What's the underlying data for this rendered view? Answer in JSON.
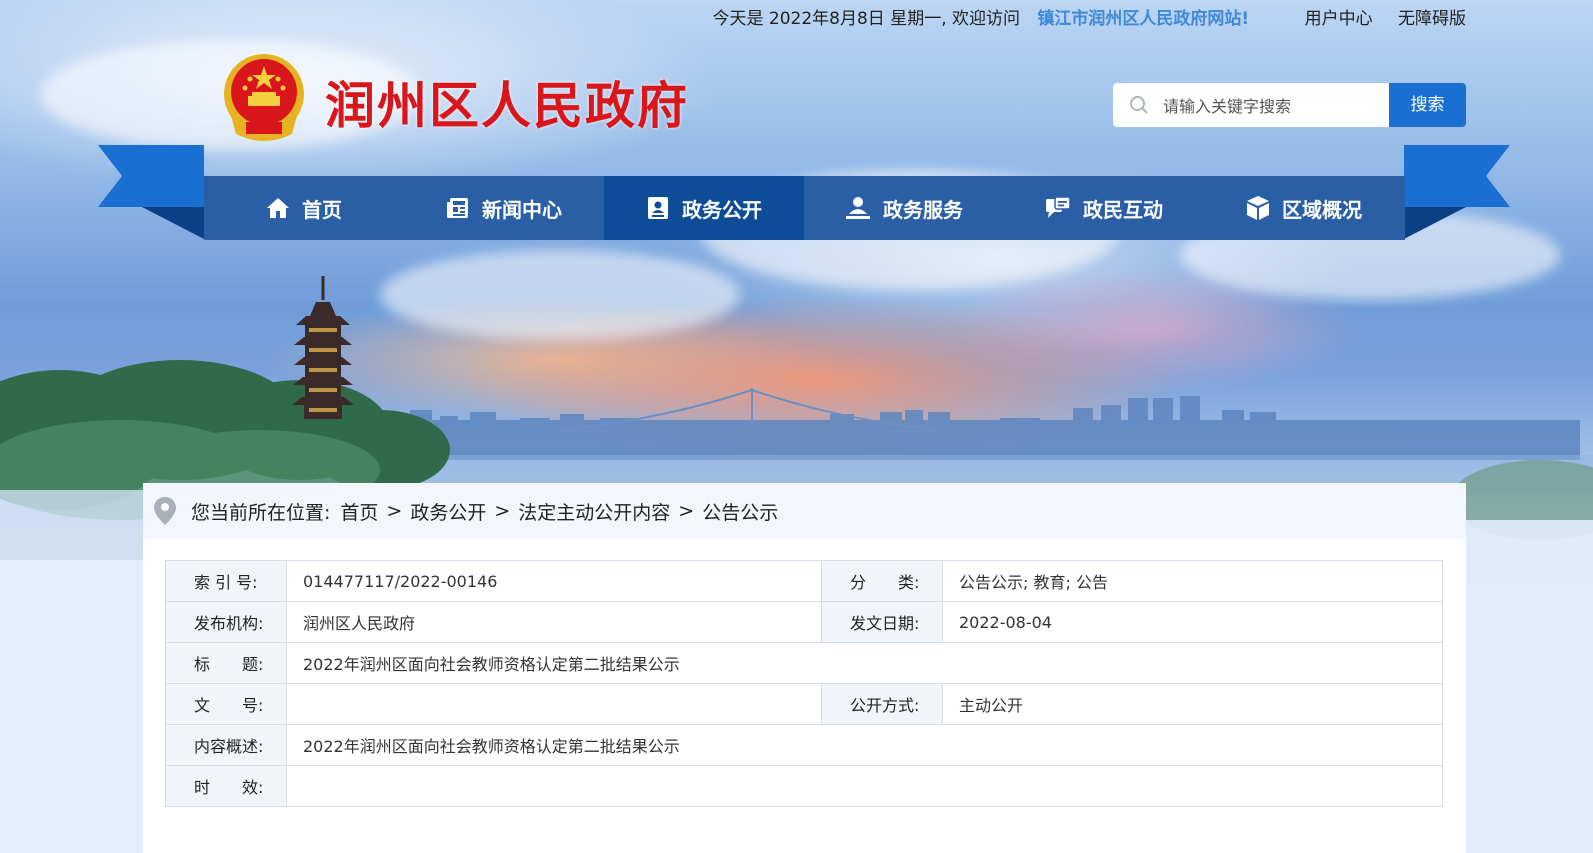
{
  "topbar": {
    "greeting": "今天是 2022年8月8日 星期一, 欢迎访问",
    "site_link": "镇江市润州区人民政府网站!",
    "user_center": "用户中心",
    "accessible": "无障碍版"
  },
  "header": {
    "title": "润州区人民政府",
    "search_placeholder": "请输入关键字搜索",
    "search_button": "搜索"
  },
  "nav": [
    {
      "label": "首页",
      "icon": "home-icon"
    },
    {
      "label": "新闻中心",
      "icon": "news-icon"
    },
    {
      "label": "政务公开",
      "icon": "id-card-icon",
      "active": true
    },
    {
      "label": "政务服务",
      "icon": "user-service-icon"
    },
    {
      "label": "政民互动",
      "icon": "chat-icon"
    },
    {
      "label": "区域概况",
      "icon": "cube-icon"
    }
  ],
  "breadcrumb": {
    "label": "您当前所在位置:",
    "items": [
      "首页",
      "政务公开",
      "法定主动公开内容",
      "公告公示"
    ],
    "separator": ">"
  },
  "meta": {
    "index_no_label": "索 引 号:",
    "index_no": "014477117/2022-00146",
    "category_label": "分　　类:",
    "category": "公告公示;  教育;  公告",
    "publisher_label": "发布机构:",
    "publisher": "润州区人民政府",
    "date_label": "发文日期:",
    "date": "2022-08-04",
    "title_label": "标　　题:",
    "title": "2022年润州区面向社会教师资格认定第二批结果公示",
    "doc_no_label": "文　　号:",
    "doc_no": "",
    "disclosure_label": "公开方式:",
    "disclosure": "主动公开",
    "summary_label": "内容概述:",
    "summary": "2022年润州区面向社会教师资格认定第二批结果公示",
    "validity_label": "时　　效:",
    "validity": ""
  },
  "colors": {
    "nav_bg": "#2a5fa6",
    "nav_active": "#0f4c98",
    "title_red": "#d9161c",
    "search_button": "#1a6fd2",
    "site_link": "#3f89d8"
  }
}
